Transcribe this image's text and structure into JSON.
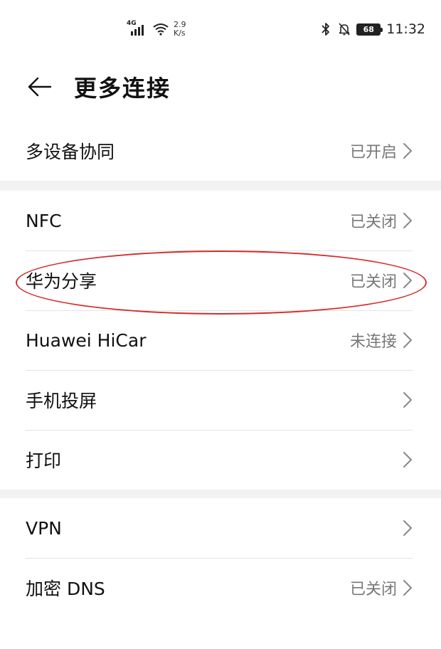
{
  "status_bar": {
    "network_type": "4G",
    "speed_value": "2.9",
    "speed_unit": "K/s",
    "battery_level": "68",
    "time": "11:32"
  },
  "header": {
    "title": "更多连接"
  },
  "groups": [
    {
      "items": [
        {
          "label": "多设备协同",
          "status": "已开启"
        }
      ]
    },
    {
      "items": [
        {
          "label": "NFC",
          "status": "已关闭"
        },
        {
          "label": "华为分享",
          "status": "已关闭"
        },
        {
          "label": "Huawei HiCar",
          "status": "未连接"
        },
        {
          "label": "手机投屏",
          "status": ""
        },
        {
          "label": "打印",
          "status": ""
        }
      ]
    },
    {
      "items": [
        {
          "label": "VPN",
          "status": ""
        },
        {
          "label": "加密 DNS",
          "status": "已关闭"
        }
      ]
    }
  ],
  "colors": {
    "annotation_ellipse": "#d42b2b",
    "section_gap": "#f2f2f2"
  }
}
